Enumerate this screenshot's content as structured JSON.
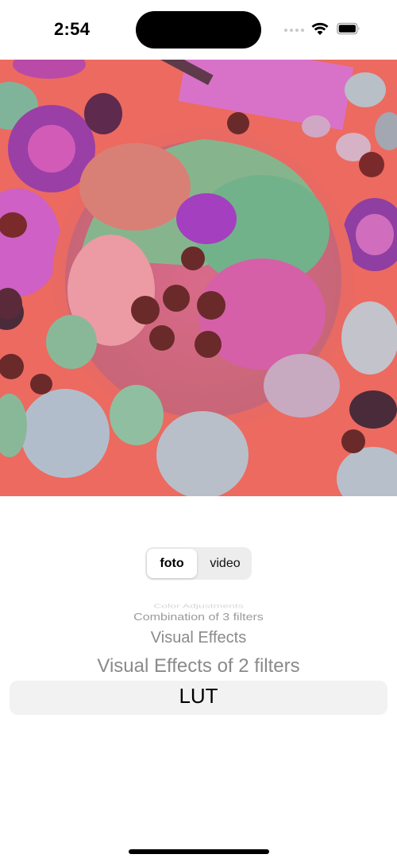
{
  "status_bar": {
    "time": "2:54",
    "icons": [
      "cellular-signal-icon",
      "wifi-icon",
      "battery-icon"
    ]
  },
  "photo": {
    "subject": "fruit-bowl-photo-with-color-filter"
  },
  "mode_toggle": {
    "options": [
      "foto",
      "video"
    ],
    "selected": "foto"
  },
  "filter_picker": {
    "items": [
      "Color Adjustments",
      "Combination of 3 filters",
      "Visual Effects",
      "Visual Effects of 2 filters",
      "LUT"
    ],
    "selected": "LUT"
  },
  "colors": {
    "filter_base": "#ec6a60",
    "magenta": "#c64fb8",
    "green": "#86b58d",
    "picker_highlight": "#f2f2f2"
  }
}
